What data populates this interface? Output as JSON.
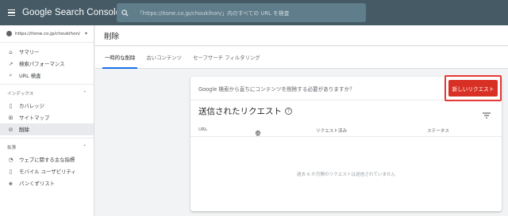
{
  "app": {
    "title": "Google Search Console"
  },
  "search": {
    "placeholder": "「https://itone.co.jp/choukihon/」内のすべての URL を検査"
  },
  "sidebar": {
    "property": "https://itone.co.jp/choukihon/",
    "items_top": [
      {
        "label": "サマリー",
        "icon": "home-icon"
      },
      {
        "label": "検索パフォーマンス",
        "icon": "trend-icon"
      },
      {
        "label": "URL 検査",
        "icon": "search-icon"
      }
    ],
    "section_index": "インデックス",
    "items_index": [
      {
        "label": "カバレッジ",
        "icon": "file-icon"
      },
      {
        "label": "サイトマップ",
        "icon": "sitemap-icon"
      },
      {
        "label": "削除",
        "icon": "hide-icon"
      }
    ],
    "section_enhancements": "拡張",
    "items_enh": [
      {
        "label": "ウェブに関する主な指標",
        "icon": "gauge-icon"
      },
      {
        "label": "モバイル ユーザビリティ",
        "icon": "phone-icon"
      },
      {
        "label": "パンくずリスト",
        "icon": "layers-icon"
      }
    ]
  },
  "main": {
    "page_title": "削除",
    "tabs": [
      {
        "label": "一時的な削除"
      },
      {
        "label": "古いコンテンツ"
      },
      {
        "label": "セーフサーチ フィルタリング"
      }
    ],
    "card": {
      "question": "Google 検索から直ちにコンテンツを削除する必要がありますか？",
      "new_request": "新しいリクエスト",
      "section_title": "送信されたリクエスト",
      "help": "?",
      "columns": [
        "URL",
        "型",
        "リクエスト済み",
        "ステータス"
      ],
      "empty": "過去 6 か月間のリクエストは送信されていません"
    }
  },
  "colors": {
    "topbar": "#455a64",
    "accent": "#1a73e8",
    "danger": "#d93025",
    "highlight": "#e53935"
  }
}
